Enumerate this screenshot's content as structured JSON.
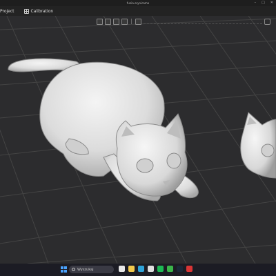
{
  "window": {
    "title": "funia.orynicamo"
  },
  "menu": {
    "project_label": "Project",
    "calibration_label": "Calibration"
  },
  "taskbar": {
    "search_placeholder": "Wyszukaj",
    "apps": [
      {
        "name": "task-view-icon",
        "color": "#e8e8e8"
      },
      {
        "name": "file-explorer-icon",
        "color": "#f2c94c"
      },
      {
        "name": "edge-icon",
        "color": "#2fa3d8"
      },
      {
        "name": "chrome-icon",
        "color": "#e0e0e0"
      },
      {
        "name": "spotify-icon",
        "color": "#1db954"
      },
      {
        "name": "app-icon-green",
        "color": "#3bb54a"
      },
      {
        "name": "steam-icon",
        "color": "#1b2838"
      },
      {
        "name": "app-icon-red",
        "color": "#d93535"
      }
    ]
  },
  "scene": {
    "background": "#2c2c2e",
    "model_color": "#e4e4e4"
  }
}
